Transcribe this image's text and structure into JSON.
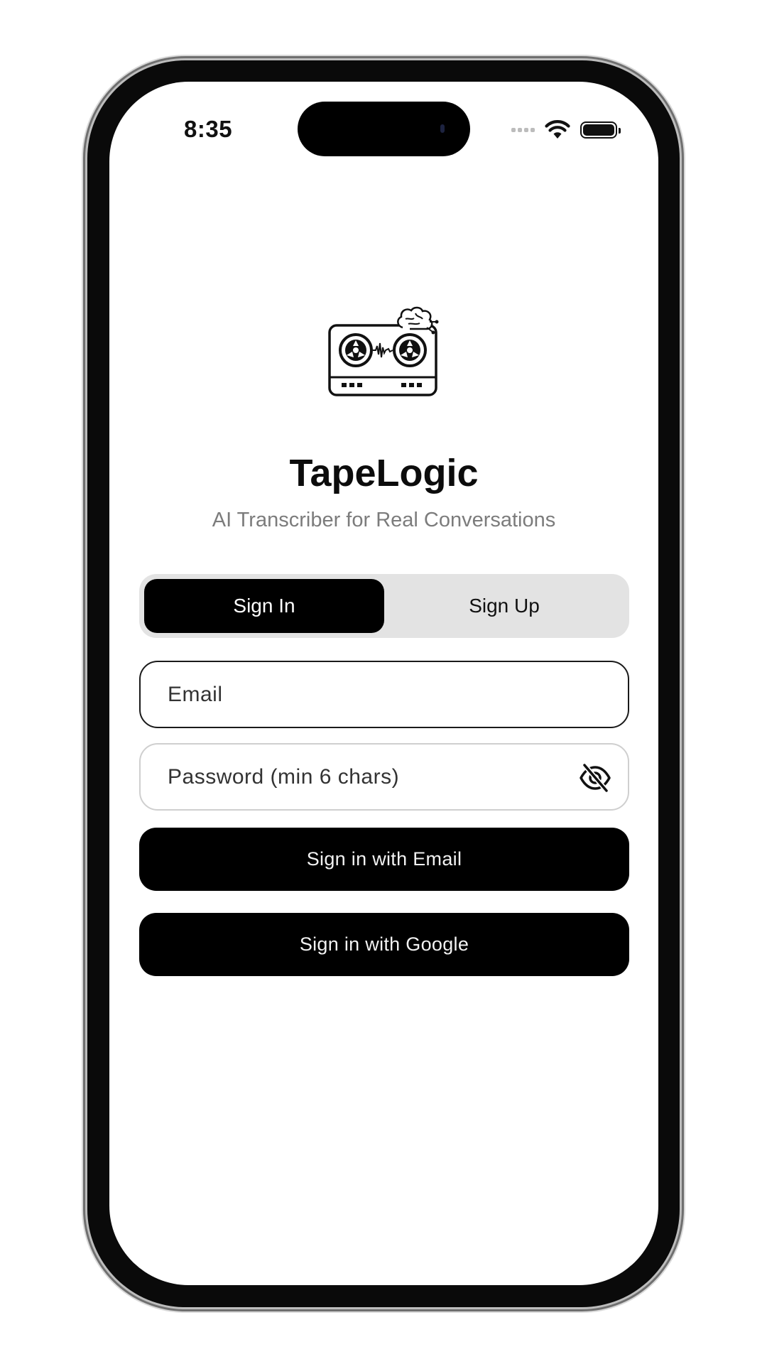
{
  "status_bar": {
    "time": "8:35"
  },
  "app": {
    "title": "TapeLogic",
    "subtitle": "AI Transcriber for Real Conversations",
    "logo_icon": "cassette-tape-brain-icon"
  },
  "auth_tabs": {
    "sign_in_label": "Sign In",
    "sign_up_label": "Sign Up",
    "selected": "Sign In"
  },
  "form": {
    "email_placeholder": "Email",
    "email_value": "",
    "password_placeholder": "Password (min 6 chars)",
    "password_value": "",
    "password_toggle_icon": "eye-off-icon"
  },
  "actions": {
    "email_button_label": "Sign in with Email",
    "google_button_label": "Sign in with Google"
  },
  "colors": {
    "accent": "#000000",
    "segment_background": "#e3e3e3",
    "subtitle": "#7c7c7c"
  }
}
